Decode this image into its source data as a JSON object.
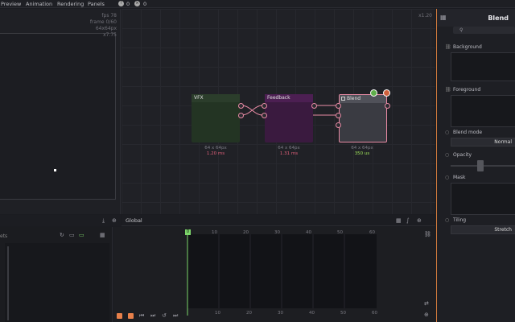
{
  "menu": {
    "items": [
      "Preview",
      "Animation",
      "Rendering",
      "Panels"
    ],
    "warnings_count": "0",
    "errors_count": "0"
  },
  "preview": {
    "stats": [
      "fps 78",
      "frame 0/60",
      "64x64px",
      "x7.75"
    ]
  },
  "graph": {
    "zoom": "x1.20",
    "nodes": [
      {
        "title": "VFX",
        "size": "64 x 64px",
        "time": "1.20 ms",
        "time_color": "#e0607a",
        "fill": "#233423"
      },
      {
        "title": "Feedback",
        "size": "64 x 64px",
        "time": "1.31 ms",
        "time_color": "#e0607a",
        "fill": "#3a1a3f"
      },
      {
        "title": "Blend",
        "size": "64 x 64px",
        "time": "350 us",
        "time_color": "#9ee05a",
        "fill": "#3a3b42"
      }
    ]
  },
  "inspector": {
    "title": "Blend",
    "background_label": "Background",
    "foreground_label": "Foreground",
    "blend_mode_label": "Blend mode",
    "blend_mode_value": "Normal",
    "opacity_label": "Opacity",
    "mask_label": "Mask",
    "tiling_label": "Tiling",
    "tiling_value": "Stretch"
  },
  "timeline": {
    "tab": "Global",
    "start_frame": "0",
    "top_ticks": [
      "10",
      "20",
      "30",
      "40",
      "50",
      "60"
    ],
    "bottom_ticks": [
      "10",
      "20",
      "30",
      "40",
      "50",
      "60"
    ]
  },
  "assets": {
    "tab_partial": "ets"
  },
  "colors": {
    "accent": "#d07a3c",
    "port": "#e88aa4",
    "playhead": "#7cd66a"
  }
}
